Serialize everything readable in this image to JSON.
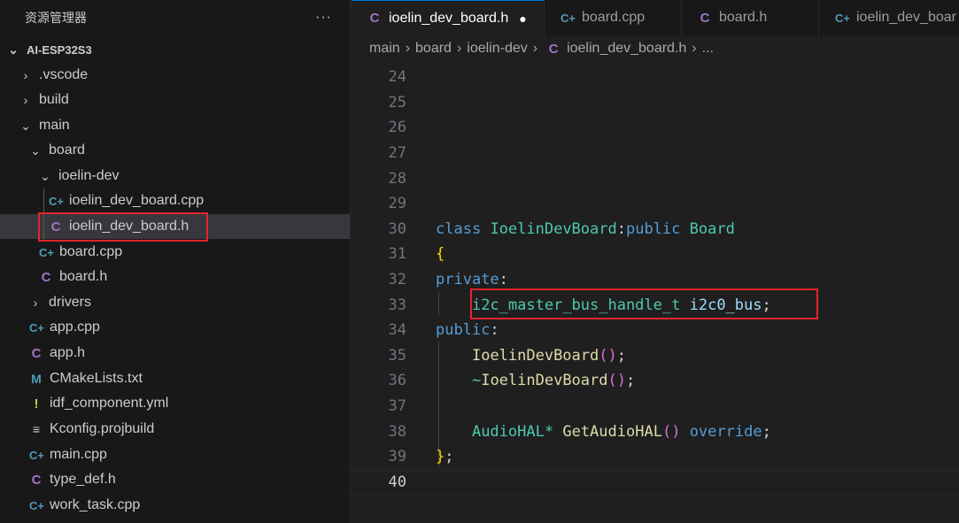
{
  "explorer": {
    "title": "资源管理器",
    "more": "···",
    "root": "AI-ESP32S3",
    "items": [
      {
        "label": ".vscode",
        "icon": "chevron-right"
      },
      {
        "label": "build",
        "icon": "chevron-right"
      },
      {
        "label": "main",
        "icon": "chevron-down"
      },
      {
        "label": "board",
        "icon": "chevron-down"
      },
      {
        "label": "ioelin-dev",
        "icon": "chevron-down"
      },
      {
        "label": "ioelin_dev_board.cpp",
        "icon": "cpp"
      },
      {
        "label": "ioelin_dev_board.h",
        "icon": "c"
      },
      {
        "label": "board.cpp",
        "icon": "cpp"
      },
      {
        "label": "board.h",
        "icon": "c"
      },
      {
        "label": "drivers",
        "icon": "chevron-right"
      },
      {
        "label": "app.cpp",
        "icon": "cpp"
      },
      {
        "label": "app.h",
        "icon": "c"
      },
      {
        "label": "CMakeLists.txt",
        "icon": "m"
      },
      {
        "label": "idf_component.yml",
        "icon": "exclamation"
      },
      {
        "label": "Kconfig.projbuild",
        "icon": "lines"
      },
      {
        "label": "main.cpp",
        "icon": "cpp"
      },
      {
        "label": "type_def.h",
        "icon": "c"
      },
      {
        "label": "work_task.cpp",
        "icon": "cpp"
      }
    ]
  },
  "icons": {
    "c": "C",
    "cpp": "C+",
    "m": "M",
    "exclamation": "!",
    "lines": "≡",
    "chevron-right": "›",
    "chevron-down": "⌄",
    "dirty": "●",
    "sep": "›"
  },
  "tabs": [
    {
      "label": "ioelin_dev_board.h",
      "icon": "c",
      "dirty": true
    },
    {
      "label": "board.cpp",
      "icon": "cpp"
    },
    {
      "label": "board.h",
      "icon": "c"
    },
    {
      "label": "ioelin_dev_boar",
      "icon": "cpp"
    }
  ],
  "breadcrumb": [
    "main",
    "board",
    "ioelin-dev",
    "ioelin_dev_board.h",
    "..."
  ],
  "code": {
    "lines": [
      {
        "n": "24",
        "t": ""
      },
      {
        "n": "25",
        "t": ""
      },
      {
        "n": "26",
        "t": ""
      },
      {
        "n": "27",
        "t": ""
      },
      {
        "n": "28",
        "t": ""
      },
      {
        "n": "29",
        "t": ""
      },
      {
        "n": "30",
        "t": "class IoelinDevBoard:public Board"
      },
      {
        "n": "31",
        "t": "{"
      },
      {
        "n": "32",
        "t": "private:"
      },
      {
        "n": "33",
        "t": "    i2c_master_bus_handle_t i2c0_bus;"
      },
      {
        "n": "34",
        "t": "public:"
      },
      {
        "n": "35",
        "t": "    IoelinDevBoard();"
      },
      {
        "n": "36",
        "t": "    ~IoelinDevBoard();"
      },
      {
        "n": "37",
        "t": ""
      },
      {
        "n": "38",
        "t": "    AudioHAL* GetAudioHAL() override;"
      },
      {
        "n": "39",
        "t": "};"
      },
      {
        "n": "40",
        "t": ""
      }
    ]
  },
  "colors": {
    "keyword": "#569cd6",
    "type": "#4ec9b0",
    "function": "#dcdcaa",
    "variable": "#9cdcfe",
    "highlight_box": "#e0262b",
    "active_tab_border": "#0078d4"
  }
}
